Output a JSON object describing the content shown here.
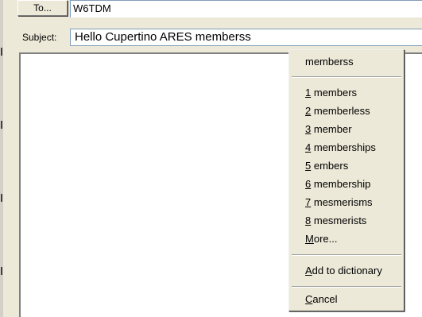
{
  "header": {
    "to_button_label": "To...",
    "to_value": "W6TDM",
    "subject_label": "Subject:",
    "subject_value": "Hello Cupertino ARES memberss"
  },
  "spell_menu": {
    "misspelled_word": "memberss",
    "suggestions": [
      {
        "number": "1",
        "word": "members"
      },
      {
        "number": "2",
        "word": "memberless"
      },
      {
        "number": "3",
        "word": "member"
      },
      {
        "number": "4",
        "word": "memberships"
      },
      {
        "number": "5",
        "word": "embers"
      },
      {
        "number": "6",
        "word": "membership"
      },
      {
        "number": "7",
        "word": "mesmerisms"
      },
      {
        "number": "8",
        "word": "mesmerists"
      }
    ],
    "more": {
      "mnemonic": "M",
      "rest": "ore..."
    },
    "add_to_dictionary": {
      "mnemonic": "A",
      "rest": "dd to dictionary"
    },
    "cancel": {
      "mnemonic": "C",
      "rest": "ancel"
    }
  }
}
